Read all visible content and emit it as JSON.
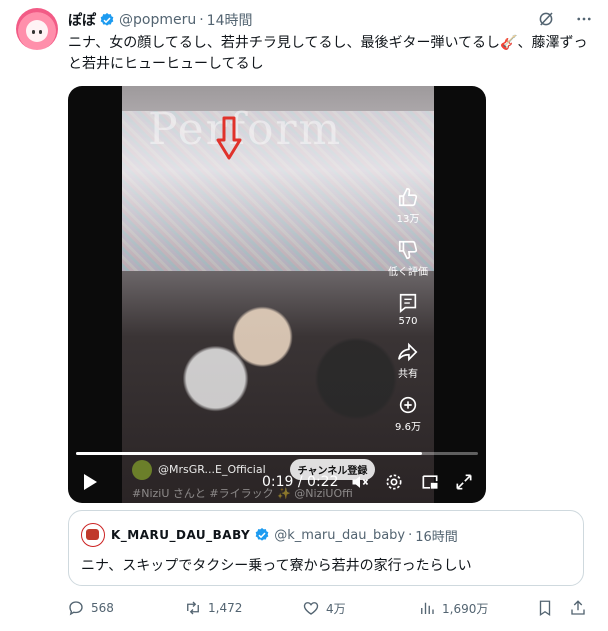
{
  "tweet": {
    "author_name": "ぽぽ",
    "handle": "@popmeru",
    "separator": "·",
    "time": "14時間",
    "text": "ニナ、女の顔してるし、若井チラ見してるし、最後ギター弾いてるし🎸、藤澤ずっと若井にヒューヒューしてるし"
  },
  "video": {
    "watermark": "Perform",
    "side_actions": [
      {
        "icon": "thumbs-up-icon",
        "label": "13万"
      },
      {
        "icon": "thumbs-down-icon",
        "label": "低く評価"
      },
      {
        "icon": "comment-icon",
        "label": "570"
      },
      {
        "icon": "share-icon",
        "label": "共有"
      },
      {
        "icon": "remix-icon",
        "label": "9.6万"
      }
    ],
    "channel": "@MrsGR...E_Official",
    "subscribe_label": "チャンネル登録",
    "tags": "#NiziU さんと #ライラック ✨ @NiziUOffi",
    "timecode": "0:19 / 0:22",
    "progress": 0.86
  },
  "quoted": {
    "name": "K_MARU_DAU_BABY",
    "handle": "@k_maru_dau_baby",
    "separator": "·",
    "time": "16時間",
    "text": "ニナ、スキップでタクシー乗って寮から若井の家行ったらしい"
  },
  "actions": {
    "replies": "568",
    "reposts": "1,472",
    "likes": "4万",
    "views": "1,690万"
  },
  "colors": {
    "verified": "#1d9bf0",
    "secondary_text": "#536471",
    "arrow": "#e0322b"
  }
}
